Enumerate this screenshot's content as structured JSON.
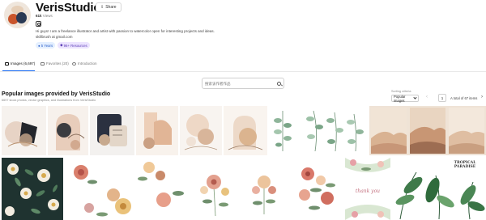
{
  "profile": {
    "name": "VerisStudio",
    "share_label": "Share",
    "stats_count": "61k",
    "stats_label": "Views",
    "bio_line1": "Hi guys! I am a freelance illustrator and artist with passion to watercolor open for interesting projects and ideas.",
    "bio_line2": "skillbrush at gmail.com",
    "badge_years": "5 Years",
    "badge_resources": "96+ Resources"
  },
  "tabs": [
    {
      "label": "Images (6,697)",
      "active": true
    },
    {
      "label": "Favorites (20)",
      "active": false
    },
    {
      "label": "Introduction",
      "active": false
    }
  ],
  "search": {
    "placeholder": "搜索该作者作品"
  },
  "section": {
    "title": "Popular images provided by VerisStudio",
    "subtitle": "6697 stock photos, vector graphics, and illustrations from VerisStudio"
  },
  "sort": {
    "label": "Sorting criteria",
    "value": "Popular images"
  },
  "pagination": {
    "prev": "‹",
    "current": "1",
    "text": "A total of 67 items",
    "next": "›"
  },
  "tiles": [
    {
      "name": "abstract-shapes-1",
      "row": 1,
      "bg": "#f6f2ee"
    },
    {
      "name": "abstract-arch-2",
      "row": 1,
      "bg": "#f7f1ec"
    },
    {
      "name": "navy-square-collage",
      "row": 1,
      "bg": "#f3f1ef"
    },
    {
      "name": "terracotta-shapes",
      "row": 1,
      "bg": "#f8f2ec"
    },
    {
      "name": "peach-circles",
      "row": 1,
      "bg": "#f8f4f0"
    },
    {
      "name": "arch-and-sun",
      "row": 1,
      "bg": "#f9f4ef"
    },
    {
      "name": "eucalyptus-branches",
      "row": 1,
      "bg": "#ffffff"
    },
    {
      "name": "eucalyptus-set",
      "row": 1,
      "bg": "#ffffff"
    },
    {
      "name": "desert-triptych",
      "row": 1,
      "bg": "#e8d8c6"
    },
    {
      "name": "dark-floral-pattern",
      "row": 2,
      "bg": "#1f3330"
    },
    {
      "name": "peony-clipart",
      "row": 2,
      "bg": "#ffffff"
    },
    {
      "name": "wildflower-bouquets",
      "row": 2,
      "bg": "#ffffff"
    },
    {
      "name": "floral-wreath",
      "row": 2,
      "bg": "#ffffff"
    },
    {
      "name": "floral-corner-frame",
      "row": 2,
      "bg": "#ffffff"
    },
    {
      "name": "tropical-leaves",
      "row": 2,
      "bg": "#ffffff"
    }
  ],
  "tile_text": {
    "thank_you": "thank you",
    "tropical": "TROPICAL PARADISE"
  }
}
